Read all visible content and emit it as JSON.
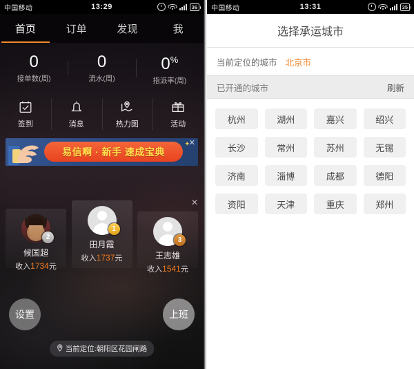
{
  "left_phone": {
    "status_bar": {
      "carrier": "中国移动",
      "time": "13:29",
      "battery": "36",
      "icons": [
        "alarm-icon",
        "wifi-icon",
        "signal-icon",
        "battery-icon"
      ]
    },
    "tabs": [
      {
        "label": "首页",
        "active": true
      },
      {
        "label": "订单",
        "active": false
      },
      {
        "label": "发现",
        "active": false
      },
      {
        "label": "我",
        "active": false
      }
    ],
    "stats": [
      {
        "value": "0",
        "suffix": "",
        "label": "接单数(周)"
      },
      {
        "value": "0",
        "suffix": "",
        "label": "流水(周)"
      },
      {
        "value": "0",
        "suffix": "%",
        "label": "指派率(周)"
      }
    ],
    "quick_actions": [
      {
        "label": "签到",
        "icon": "calendar-check-icon"
      },
      {
        "label": "消息",
        "icon": "bell-icon"
      },
      {
        "label": "热力图",
        "icon": "map-pin-icon"
      },
      {
        "label": "活动",
        "icon": "gift-icon"
      }
    ],
    "banner": {
      "text": "易信啊 · 新手 速成宝典",
      "close": "✕",
      "accent": "#e8431f",
      "text_color": "#ffe14d"
    },
    "leaderboard": {
      "close": "✕",
      "items": [
        {
          "rank": "2",
          "name": "候国超",
          "income_prefix": "收入",
          "income": "1734",
          "income_suffix": "元",
          "avatar": "photo"
        },
        {
          "rank": "1",
          "name": "田月霞",
          "income_prefix": "收入",
          "income": "1737",
          "income_suffix": "元",
          "avatar": "silhouette"
        },
        {
          "rank": "3",
          "name": "王志雄",
          "income_prefix": "收入",
          "income": "1541",
          "income_suffix": "元",
          "avatar": "silhouette"
        }
      ]
    },
    "buttons": {
      "settings": "设置",
      "work": "上班"
    },
    "location": {
      "icon": "location-pin-icon",
      "text": "当前定位:朝阳区花园闸路"
    }
  },
  "right_phone": {
    "status_bar": {
      "carrier": "中国移动",
      "time": "13:31",
      "battery": "35",
      "icons": [
        "alarm-icon",
        "wifi-icon",
        "signal-icon",
        "battery-icon"
      ]
    },
    "nav_title": "选择承运城市",
    "current_city": {
      "label": "当前定位的城市",
      "value": "北京市",
      "value_color": "#f0832a"
    },
    "section": {
      "title": "已开通的城市",
      "action": "刷新"
    },
    "cities": [
      "杭州",
      "湖州",
      "嘉兴",
      "绍兴",
      "长沙",
      "常州",
      "苏州",
      "无锡",
      "济南",
      "淄博",
      "成都",
      "德阳",
      "资阳",
      "天津",
      "重庆",
      "郑州"
    ]
  }
}
